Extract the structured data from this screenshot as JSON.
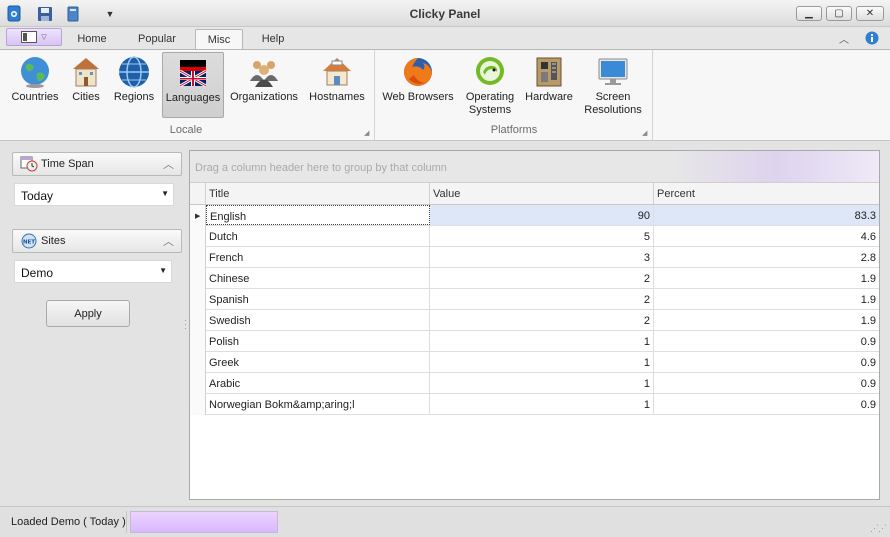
{
  "window": {
    "title": "Clicky Panel"
  },
  "tabs": [
    {
      "label": "Home",
      "active": false
    },
    {
      "label": "Popular",
      "active": false
    },
    {
      "label": "Misc",
      "active": true
    },
    {
      "label": "Help",
      "active": false
    }
  ],
  "ribbon": {
    "locale_group": "Locale",
    "platforms_group": "Platforms",
    "buttons": [
      {
        "label": "Countries",
        "icon": "globe-icon"
      },
      {
        "label": "Cities",
        "icon": "building-icon"
      },
      {
        "label": "Regions",
        "icon": "globe-network-icon"
      },
      {
        "label": "Languages",
        "icon": "flag-icon",
        "pressed": true
      },
      {
        "label": "Organizations",
        "icon": "people-icon"
      },
      {
        "label": "Hostnames",
        "icon": "house-icon"
      },
      {
        "label": "Web Browsers",
        "icon": "firefox-icon"
      },
      {
        "label": "Operating Systems",
        "icon": "opensuse-icon"
      },
      {
        "label": "Hardware",
        "icon": "circuit-board-icon"
      },
      {
        "label": "Screen Resolutions",
        "icon": "monitor-icon"
      }
    ]
  },
  "sidebar": {
    "time_span": {
      "label": "Time Span",
      "value": "Today"
    },
    "sites": {
      "label": "Sites",
      "value": "Demo"
    },
    "apply_label": "Apply"
  },
  "grid": {
    "group_hint": "Drag a column header here to group by that column",
    "columns": [
      "Title",
      "Value",
      "Percent"
    ],
    "rows": [
      {
        "title": "English",
        "value": "90",
        "percent": "83.3"
      },
      {
        "title": "Dutch",
        "value": "5",
        "percent": "4.6"
      },
      {
        "title": "French",
        "value": "3",
        "percent": "2.8"
      },
      {
        "title": "Chinese",
        "value": "2",
        "percent": "1.9"
      },
      {
        "title": "Spanish",
        "value": "2",
        "percent": "1.9"
      },
      {
        "title": "Swedish",
        "value": "2",
        "percent": "1.9"
      },
      {
        "title": "Polish",
        "value": "1",
        "percent": "0.9"
      },
      {
        "title": "Greek",
        "value": "1",
        "percent": "0.9"
      },
      {
        "title": "Arabic",
        "value": "1",
        "percent": "0.9"
      },
      {
        "title": "Norwegian Bokm&amp;aring;l",
        "value": "1",
        "percent": "0.9"
      }
    ]
  },
  "status": {
    "text": "Loaded Demo ( Today )",
    "progress": 1.0
  },
  "colors": {
    "accent": "#d9b8ff",
    "selection": "#dde7f7"
  }
}
